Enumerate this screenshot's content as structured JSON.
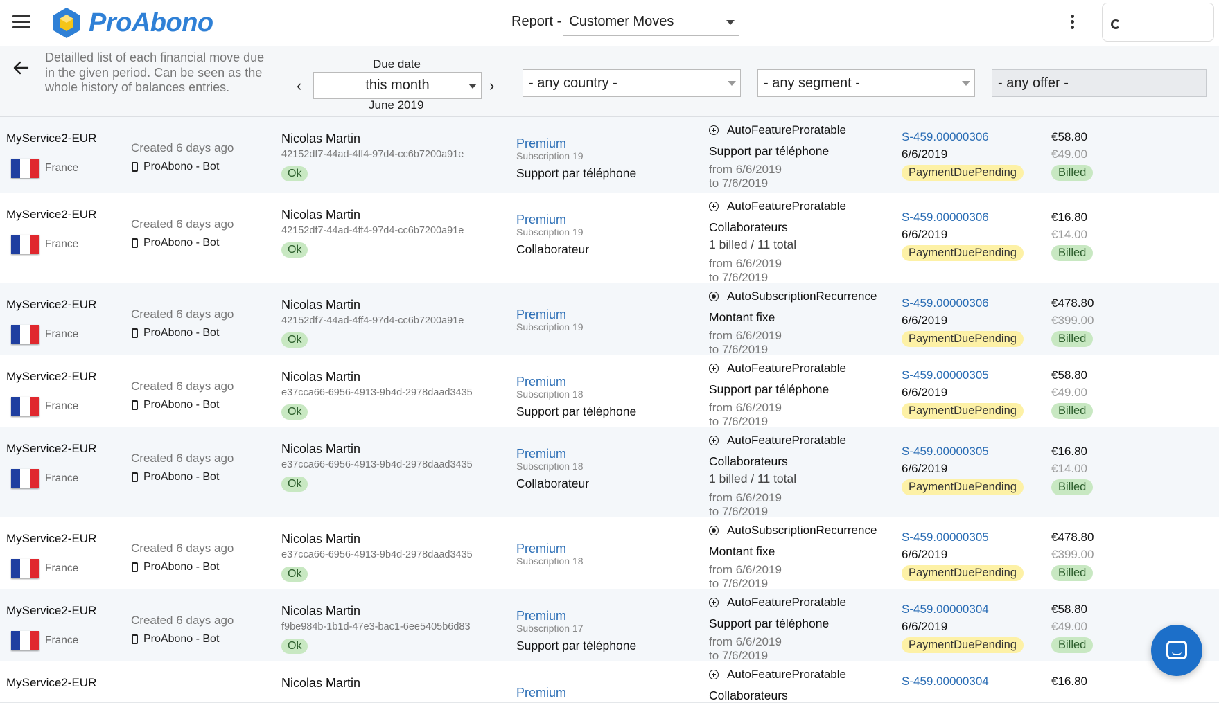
{
  "app": {
    "name": "ProAbono",
    "report_label": "Report -",
    "report_value": "Customer Moves"
  },
  "filters": {
    "description": "Detailled list of each financial move due in the given period. Can be seen as the whole history of balances entries.",
    "due_date_label": "Due date",
    "due_date_value": "this month",
    "due_date_sub": "June 2019",
    "country": "- any country -",
    "segment": "- any segment -",
    "offer": "- any offer -"
  },
  "colors": {
    "brand_blue": "#2f80d6",
    "link_blue": "#2a6db5",
    "ok_green": "#c8e8c2",
    "pending_yellow": "#fdf1a6",
    "row_alt": "#f4f7fa"
  },
  "icons": {
    "menu": "hamburger-icon",
    "more": "kebab-icon",
    "back": "arrow-left-icon",
    "prev": "chevron-left-icon",
    "next": "chevron-right-icon",
    "device": "phone-icon",
    "feature": "plus-circle-icon",
    "recurrence": "radio-dot-icon",
    "chat": "chat-icon"
  },
  "rows": [
    {
      "service": "MyService2-EUR",
      "country": "France",
      "created": "Created 6 days ago",
      "bot": "ProAbono - Bot",
      "customer": "Nicolas Martin",
      "uuid": "42152df7-44ad-4ff4-97d4-cc6b7200a91e",
      "status": "Ok",
      "offer": "Premium",
      "subscription": "Subscription 19",
      "feature": "Support par téléphone",
      "move_type": "AutoFeatureProratable",
      "move_icon": "plus",
      "move_label": "Support par téléphone",
      "move_qty": "",
      "from": "from 6/6/2019",
      "to": "to 7/6/2019",
      "invoice": "S-459.00000306",
      "invoice_date": "6/6/2019",
      "payment": "PaymentDuePending",
      "amount": "€58.80",
      "amount_ht": "€49.00",
      "billed": "Billed"
    },
    {
      "service": "MyService2-EUR",
      "country": "France",
      "created": "Created 6 days ago",
      "bot": "ProAbono - Bot",
      "customer": "Nicolas Martin",
      "uuid": "42152df7-44ad-4ff4-97d4-cc6b7200a91e",
      "status": "Ok",
      "offer": "Premium",
      "subscription": "Subscription 19",
      "feature": "Collaborateur",
      "move_type": "AutoFeatureProratable",
      "move_icon": "plus",
      "move_label": "Collaborateurs",
      "move_qty": "1 billed / 11 total",
      "from": "from 6/6/2019",
      "to": "to 7/6/2019",
      "invoice": "S-459.00000306",
      "invoice_date": "6/6/2019",
      "payment": "PaymentDuePending",
      "amount": "€16.80",
      "amount_ht": "€14.00",
      "billed": "Billed"
    },
    {
      "service": "MyService2-EUR",
      "country": "France",
      "created": "Created 6 days ago",
      "bot": "ProAbono - Bot",
      "customer": "Nicolas Martin",
      "uuid": "42152df7-44ad-4ff4-97d4-cc6b7200a91e",
      "status": "Ok",
      "offer": "Premium",
      "subscription": "Subscription 19",
      "feature": "",
      "move_type": "AutoSubscriptionRecurrence",
      "move_icon": "dot",
      "move_label": "Montant fixe",
      "move_qty": "",
      "from": "from 6/6/2019",
      "to": "to 7/6/2019",
      "invoice": "S-459.00000306",
      "invoice_date": "6/6/2019",
      "payment": "PaymentDuePending",
      "amount": "€478.80",
      "amount_ht": "€399.00",
      "billed": "Billed"
    },
    {
      "service": "MyService2-EUR",
      "country": "France",
      "created": "Created 6 days ago",
      "bot": "ProAbono - Bot",
      "customer": "Nicolas Martin",
      "uuid": "e37cca66-6956-4913-9b4d-2978daad3435",
      "status": "Ok",
      "offer": "Premium",
      "subscription": "Subscription 18",
      "feature": "Support par téléphone",
      "move_type": "AutoFeatureProratable",
      "move_icon": "plus",
      "move_label": "Support par téléphone",
      "move_qty": "",
      "from": "from 6/6/2019",
      "to": "to 7/6/2019",
      "invoice": "S-459.00000305",
      "invoice_date": "6/6/2019",
      "payment": "PaymentDuePending",
      "amount": "€58.80",
      "amount_ht": "€49.00",
      "billed": "Billed"
    },
    {
      "service": "MyService2-EUR",
      "country": "France",
      "created": "Created 6 days ago",
      "bot": "ProAbono - Bot",
      "customer": "Nicolas Martin",
      "uuid": "e37cca66-6956-4913-9b4d-2978daad3435",
      "status": "Ok",
      "offer": "Premium",
      "subscription": "Subscription 18",
      "feature": "Collaborateur",
      "move_type": "AutoFeatureProratable",
      "move_icon": "plus",
      "move_label": "Collaborateurs",
      "move_qty": "1 billed / 11 total",
      "from": "from 6/6/2019",
      "to": "to 7/6/2019",
      "invoice": "S-459.00000305",
      "invoice_date": "6/6/2019",
      "payment": "PaymentDuePending",
      "amount": "€16.80",
      "amount_ht": "€14.00",
      "billed": "Billed"
    },
    {
      "service": "MyService2-EUR",
      "country": "France",
      "created": "Created 6 days ago",
      "bot": "ProAbono - Bot",
      "customer": "Nicolas Martin",
      "uuid": "e37cca66-6956-4913-9b4d-2978daad3435",
      "status": "Ok",
      "offer": "Premium",
      "subscription": "Subscription 18",
      "feature": "",
      "move_type": "AutoSubscriptionRecurrence",
      "move_icon": "dot",
      "move_label": "Montant fixe",
      "move_qty": "",
      "from": "from 6/6/2019",
      "to": "to 7/6/2019",
      "invoice": "S-459.00000305",
      "invoice_date": "6/6/2019",
      "payment": "PaymentDuePending",
      "amount": "€478.80",
      "amount_ht": "€399.00",
      "billed": "Billed"
    },
    {
      "service": "MyService2-EUR",
      "country": "France",
      "created": "Created 6 days ago",
      "bot": "ProAbono - Bot",
      "customer": "Nicolas Martin",
      "uuid": "f9be984b-1b1d-47e3-bac1-6ee5405b6d83",
      "status": "Ok",
      "offer": "Premium",
      "subscription": "Subscription 17",
      "feature": "Support par téléphone",
      "move_type": "AutoFeatureProratable",
      "move_icon": "plus",
      "move_label": "Support par téléphone",
      "move_qty": "",
      "from": "from 6/6/2019",
      "to": "to 7/6/2019",
      "invoice": "S-459.00000304",
      "invoice_date": "6/6/2019",
      "payment": "PaymentDuePending",
      "amount": "€58.80",
      "amount_ht": "€49.00",
      "billed": "Billed"
    },
    {
      "service": "MyService2-EUR",
      "country": "",
      "created": "",
      "bot": "",
      "customer": "Nicolas Martin",
      "uuid": "",
      "status": "",
      "offer": "Premium",
      "subscription": "",
      "feature": "",
      "move_type": "AutoFeatureProratable",
      "move_icon": "plus",
      "move_label": "Collaborateurs",
      "move_qty": "",
      "from": "",
      "to": "",
      "invoice": "S-459.00000304",
      "invoice_date": "",
      "payment": "",
      "amount": "€16.80",
      "amount_ht": "",
      "billed": ""
    }
  ]
}
